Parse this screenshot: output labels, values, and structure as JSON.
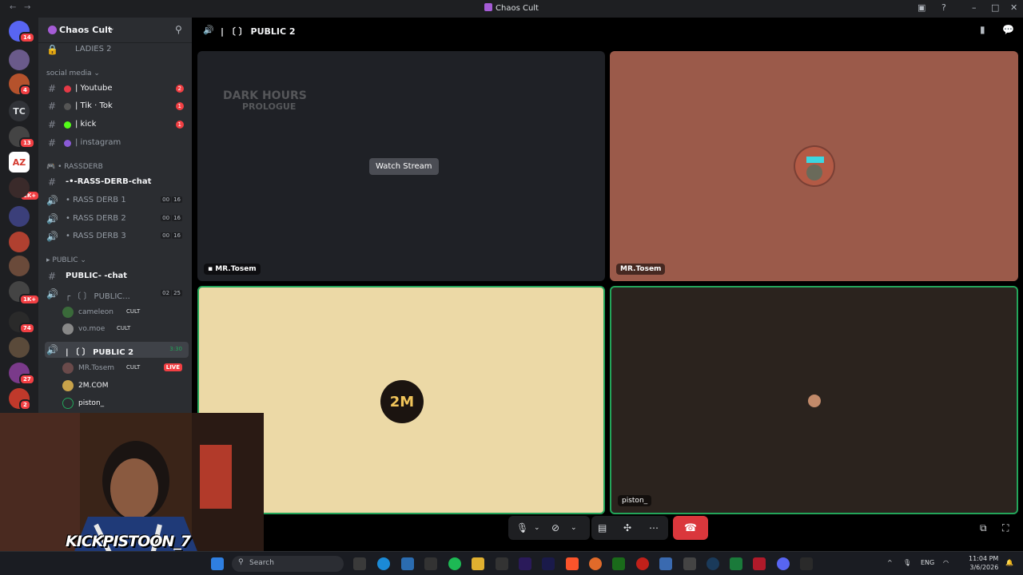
{
  "window": {
    "title": "Chaos Cult"
  },
  "server": {
    "name": "Chaos Cult"
  },
  "guild_badges": [
    "14",
    "4",
    "13",
    "1K+",
    "1K+",
    "74",
    "27",
    "2"
  ],
  "guild_text": [
    "TC",
    "AZ"
  ],
  "channels": {
    "ladies2": "LADIES 2",
    "cat_social": "social media",
    "youtube": "| Youtube",
    "youtube_count": "2",
    "tiktok": "| Tik · Tok",
    "tiktok_count": "1",
    "kick": "| kick",
    "kick_count": "1",
    "instagram": "| instagram",
    "cat_rass": "RASSDERB",
    "rass_chat": "-•-RASS-DERB-chat",
    "rass1": "• RASS DERB 1",
    "rass2": "• RASS DERB 2",
    "rass3": "• RASS DERB 3",
    "vc_left": "00",
    "vc_right": "16",
    "cat_public": "PUBLIC",
    "public_chat": "PUBLIC- -chat",
    "public1": "┌ 〔 〕 PUBLIC...",
    "public1_vc_left": "02",
    "public1_vc_right": "25",
    "public2": "| 〔 〕 PUBLIC 2",
    "public2_time": "3:30"
  },
  "voice_users_public1": [
    {
      "name": "cameleon",
      "tag": "CULT"
    },
    {
      "name": "vo.moe",
      "tag": "CULT"
    }
  ],
  "voice_users_public2": [
    {
      "name": "MR.Tosem",
      "tag": "CULT",
      "live": "LIVE"
    },
    {
      "name": "2M.COM"
    },
    {
      "name": "piston_"
    }
  ],
  "main": {
    "channel_title": "| 〔 〕 PUBLIC 2",
    "watch_stream": "Watch Stream",
    "stream_preview_title": "DARK HOURS",
    "stream_preview_subtitle": "PROLOGUE",
    "tiles": [
      {
        "name": "MR.Tosem",
        "bg": "#1f2126"
      },
      {
        "name": "MR.Tosem",
        "bg": "#9b5a4a"
      },
      {
        "name": "",
        "bg": "#ecd9a6",
        "avatar_text": "2M"
      },
      {
        "name": "piston_",
        "bg": "#2b231e"
      }
    ]
  },
  "webcam": {
    "overlay_text": "KICKPISTOON_7"
  },
  "taskbar": {
    "search_placeholder": "Search",
    "lang": "ENG",
    "time": "11:04 PM",
    "date": "3/6/2026"
  },
  "colors": {
    "accent_green": "#23a55a",
    "hangup_red": "#da373c",
    "badge_red": "#f23f43"
  }
}
